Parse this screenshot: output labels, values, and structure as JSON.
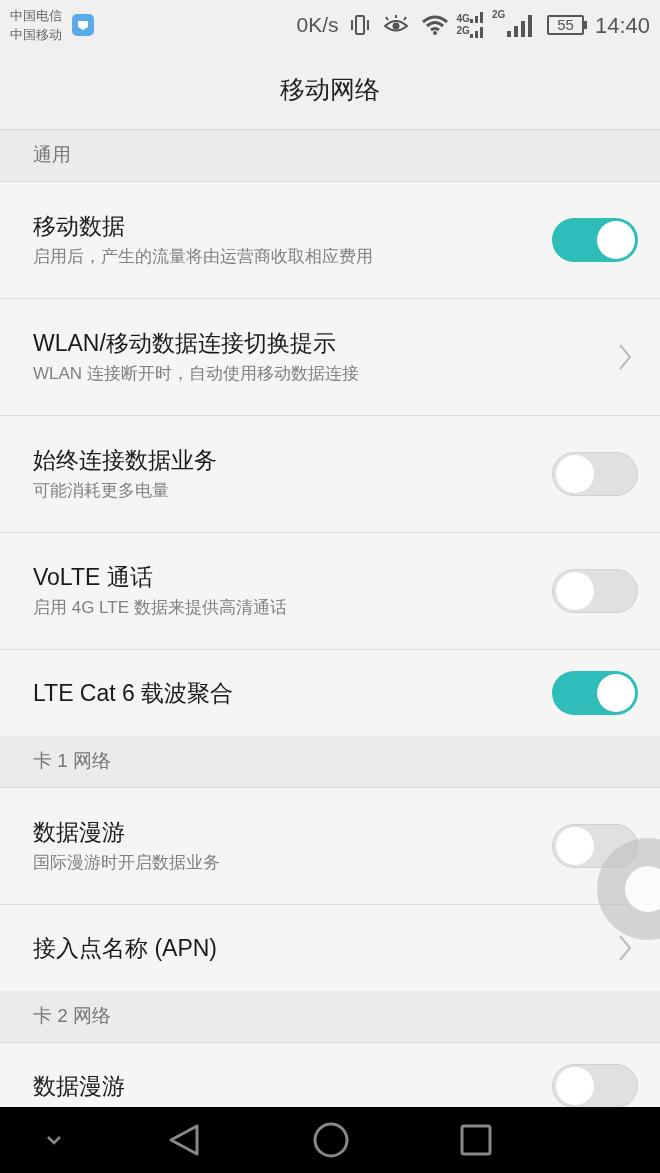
{
  "status_bar": {
    "carriers": [
      "中国电信",
      "中国移动"
    ],
    "speed": "0K/s",
    "sim1_types": [
      "4G",
      "2G"
    ],
    "sim2_type": "2G",
    "battery": "55",
    "time": "14:40"
  },
  "title": "移动网络",
  "sections": [
    {
      "header": "通用",
      "items": [
        {
          "kind": "toggle",
          "title": "移动数据",
          "subtitle": "启用后，产生的流量将由运营商收取相应费用",
          "on": true
        },
        {
          "kind": "link",
          "title": "WLAN/移动数据连接切换提示",
          "subtitle": "WLAN 连接断开时，自动使用移动数据连接"
        },
        {
          "kind": "toggle",
          "title": "始终连接数据业务",
          "subtitle": "可能消耗更多电量",
          "on": false
        },
        {
          "kind": "toggle",
          "title": "VoLTE 通话",
          "subtitle": "启用 4G LTE 数据来提供高清通话",
          "on": false
        },
        {
          "kind": "toggle",
          "title": "LTE Cat 6 载波聚合",
          "on": true
        }
      ]
    },
    {
      "header": "卡 1 网络",
      "items": [
        {
          "kind": "toggle",
          "title": "数据漫游",
          "subtitle": "国际漫游时开启数据业务",
          "on": false
        },
        {
          "kind": "link",
          "title": "接入点名称 (APN)"
        }
      ]
    },
    {
      "header": "卡 2 网络",
      "items": [
        {
          "kind": "toggle",
          "title": "数据漫游",
          "on": false
        }
      ]
    }
  ]
}
